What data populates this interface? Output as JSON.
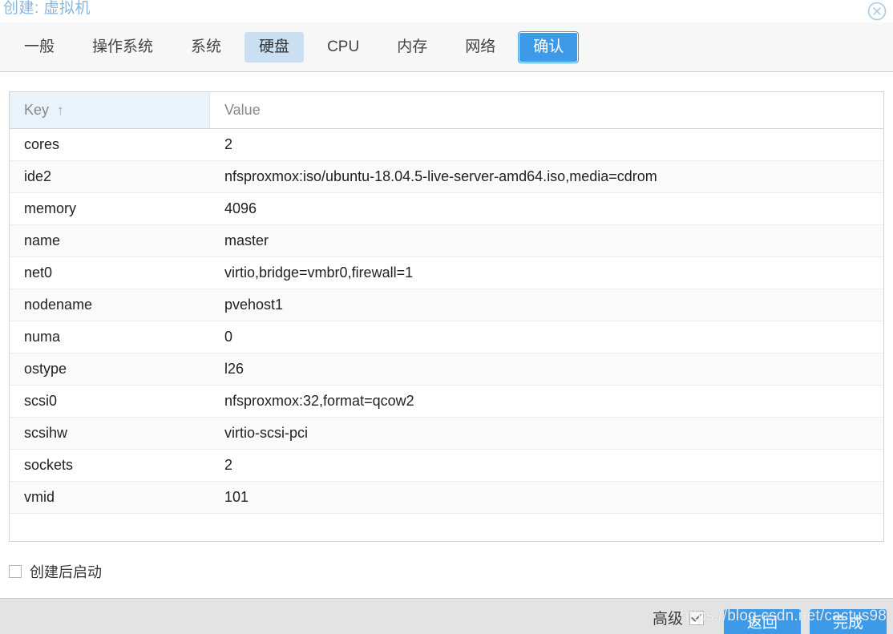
{
  "window": {
    "title": "创建: 虚拟机",
    "close_icon": "close-circle-icon"
  },
  "tabs": [
    {
      "label": "一般",
      "state": "normal"
    },
    {
      "label": "操作系统",
      "state": "normal"
    },
    {
      "label": "系统",
      "state": "normal"
    },
    {
      "label": "硬盘",
      "state": "hover"
    },
    {
      "label": "CPU",
      "state": "normal"
    },
    {
      "label": "内存",
      "state": "normal"
    },
    {
      "label": "网络",
      "state": "normal"
    },
    {
      "label": "确认",
      "state": "active"
    }
  ],
  "grid": {
    "columns": [
      {
        "label": "Key",
        "sorted": true,
        "sort_icon": "arrow-up-icon"
      },
      {
        "label": "Value",
        "sorted": false,
        "sort_icon": ""
      }
    ],
    "rows": [
      {
        "key": "cores",
        "value": "2"
      },
      {
        "key": "ide2",
        "value": "nfsproxmox:iso/ubuntu-18.04.5-live-server-amd64.iso,media=cdrom"
      },
      {
        "key": "memory",
        "value": "4096"
      },
      {
        "key": "name",
        "value": "master"
      },
      {
        "key": "net0",
        "value": "virtio,bridge=vmbr0,firewall=1"
      },
      {
        "key": "nodename",
        "value": "pvehost1"
      },
      {
        "key": "numa",
        "value": "0"
      },
      {
        "key": "ostype",
        "value": "l26"
      },
      {
        "key": "scsi0",
        "value": "nfsproxmox:32,format=qcow2"
      },
      {
        "key": "scsihw",
        "value": "virtio-scsi-pci"
      },
      {
        "key": "sockets",
        "value": "2"
      },
      {
        "key": "vmid",
        "value": "101"
      }
    ]
  },
  "startup": {
    "label": "创建后启动",
    "checked": false
  },
  "toolbar": {
    "advanced_label": "高级",
    "advanced_checked": true,
    "back_label": "返回",
    "finish_label": "完成"
  },
  "watermark": {
    "text": "https://blog.csdn.net/cactus98"
  },
  "colors": {
    "accent": "#3c9ae8",
    "tab_hover": "#cbdff2",
    "title": "#8ab6de",
    "header_sorted": "#eaf2fa",
    "toolbar_bg": "#e3e3e3",
    "row_alt": "#fafafa"
  }
}
